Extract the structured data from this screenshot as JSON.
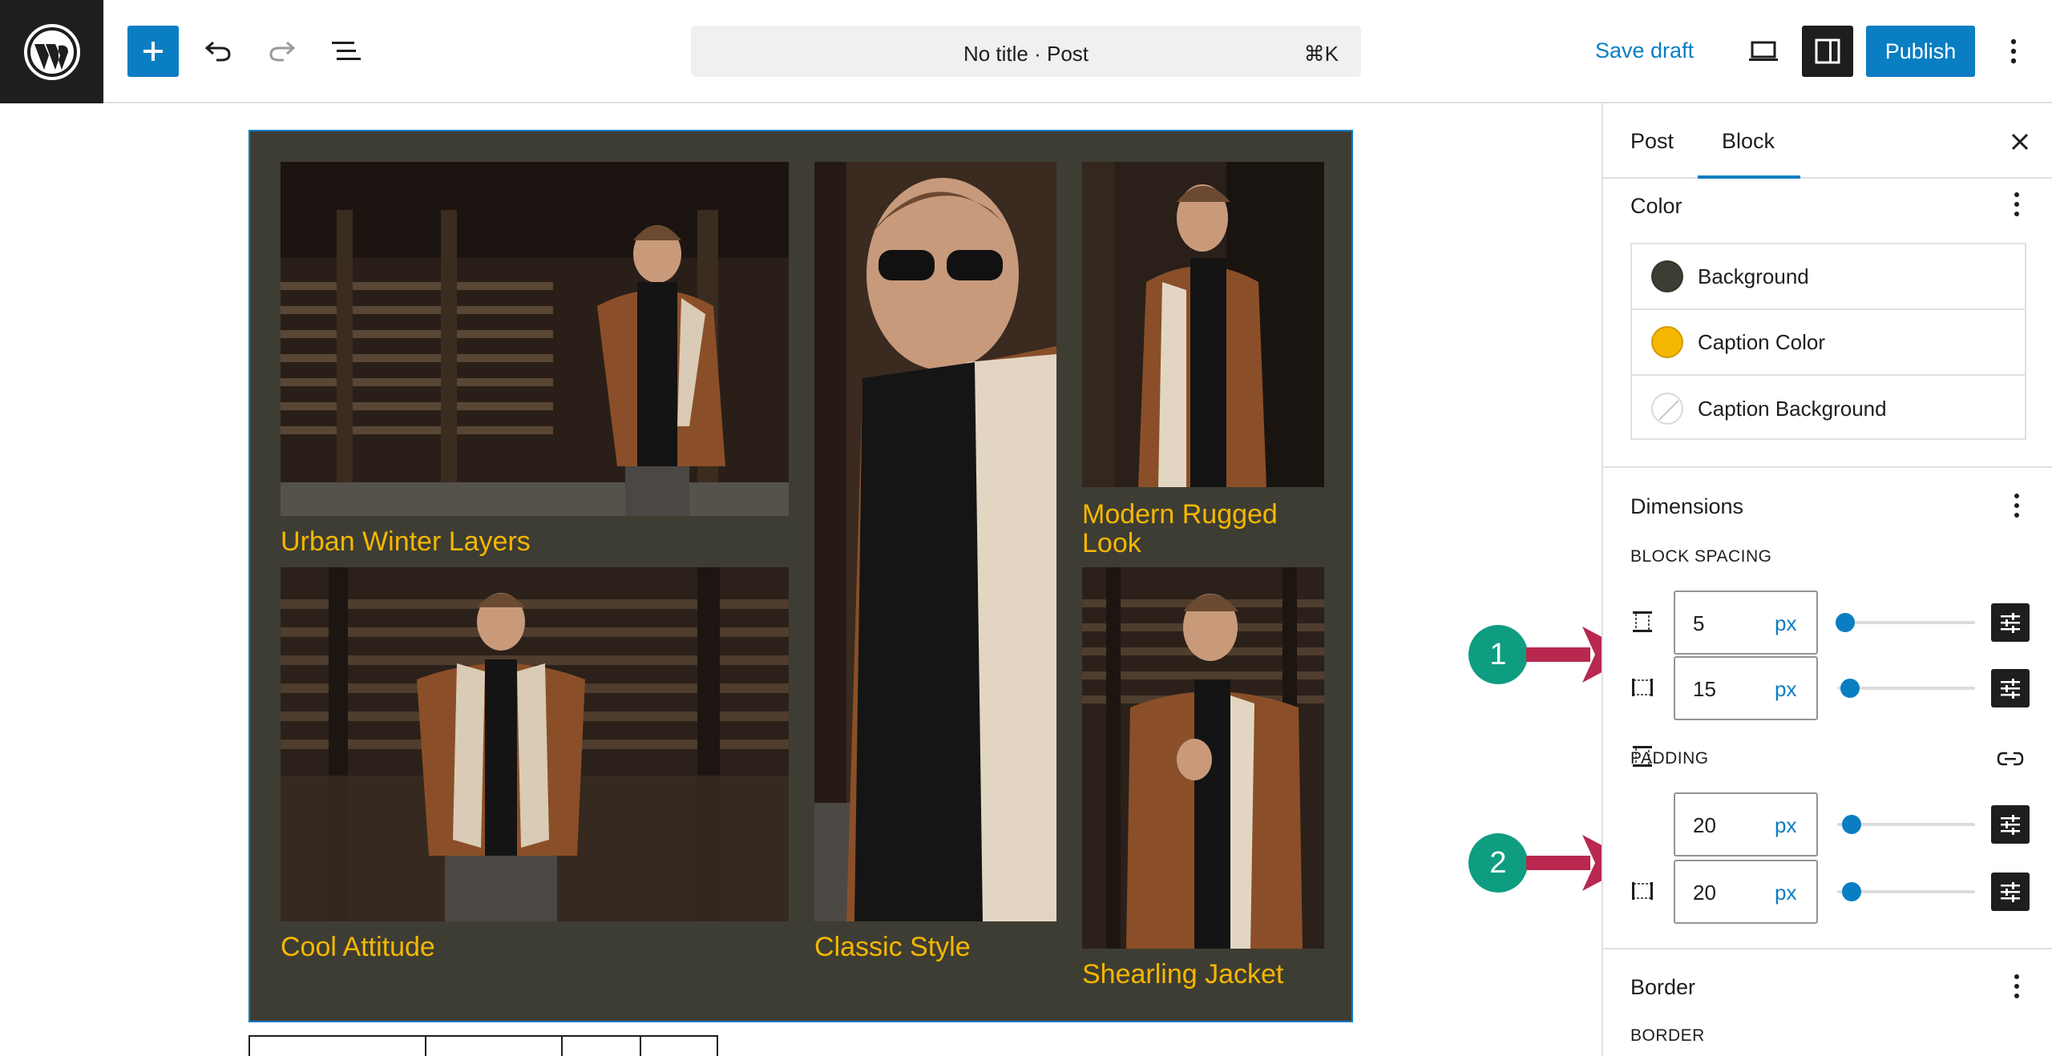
{
  "topbar": {
    "command_title": "No title · Post",
    "command_shortcut": "⌘K",
    "save_draft_label": "Save draft",
    "publish_label": "Publish"
  },
  "gallery": {
    "background": "#3e3d33",
    "caption_color": "#f5b700",
    "items": [
      {
        "caption": "Urban Winter Layers"
      },
      {
        "caption": "Cool Attitude"
      },
      {
        "caption": "Classic Style"
      },
      {
        "caption": "Modern Rugged Look"
      },
      {
        "caption": "Shearling Jacket"
      }
    ]
  },
  "annotations": {
    "badge_1": "1",
    "badge_2": "2",
    "arrow_color": "#b8284f",
    "badge_color": "#0e9d80"
  },
  "sidebar": {
    "tabs": [
      {
        "label": "Post"
      },
      {
        "label": "Block",
        "active": true
      }
    ],
    "color_panel": {
      "title": "Color",
      "items": [
        {
          "label": "Background",
          "swatch": "#3e3d33"
        },
        {
          "label": "Caption Color",
          "swatch": "#f5b700"
        },
        {
          "label": "Caption Background",
          "swatch": "none"
        }
      ]
    },
    "dimensions_panel": {
      "title": "Dimensions",
      "block_spacing_label": "BLOCK SPACING",
      "block_spacing": [
        {
          "value": "5",
          "unit": "px",
          "slider_fraction": 0.05
        },
        {
          "value": "15",
          "unit": "px",
          "slider_fraction": 0.08
        }
      ],
      "padding_label": "PADDING",
      "padding": [
        {
          "value": "20",
          "unit": "px",
          "slider_fraction": 0.1
        },
        {
          "value": "20",
          "unit": "px",
          "slider_fraction": 0.1
        }
      ]
    },
    "border_panel": {
      "title": "Border",
      "border_label": "BORDER"
    }
  },
  "colors": {
    "accent": "#0a7ec2",
    "dark": "#1e1e1e"
  }
}
